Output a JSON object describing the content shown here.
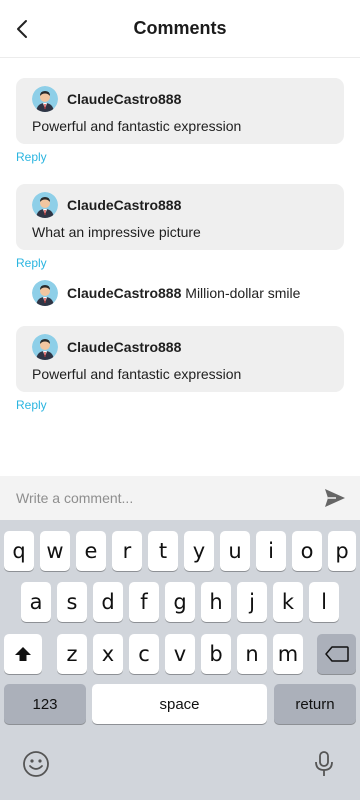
{
  "header": {
    "title": "Comments"
  },
  "comments": [
    {
      "username": "ClaudeCastro888",
      "text": "Powerful and fantastic expression",
      "reply_label": "Reply"
    },
    {
      "username": "ClaudeCastro888",
      "text": "What an impressive picture",
      "reply_label": "Reply"
    },
    {
      "username": "ClaudeCastro888",
      "text": "Million-dollar smile"
    },
    {
      "username": "ClaudeCastro888",
      "text": "Powerful and fantastic expression",
      "reply_label": "Reply"
    }
  ],
  "composer": {
    "placeholder": "Write a comment...",
    "value": ""
  },
  "keyboard": {
    "row1": [
      "q",
      "w",
      "e",
      "r",
      "t",
      "y",
      "u",
      "i",
      "o",
      "p"
    ],
    "row2": [
      "a",
      "s",
      "d",
      "f",
      "g",
      "h",
      "j",
      "k",
      "l"
    ],
    "row3": [
      "z",
      "x",
      "c",
      "v",
      "b",
      "n",
      "m"
    ],
    "numbers_label": "123",
    "space_label": "space",
    "return_label": "return"
  },
  "colors": {
    "accent": "#2bb5e0",
    "card_bg": "#efefef",
    "keyboard_bg": "#d1d5db",
    "avatar_bg": "#8ecfe8"
  }
}
